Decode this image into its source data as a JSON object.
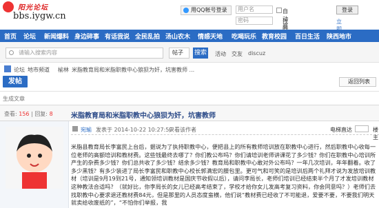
{
  "site": {
    "logo_cn": "阳光论坛",
    "logo_url": "bbs.iygw.cn"
  },
  "login": {
    "qq_label": "用QQ帐号登录",
    "user_placeholder": "用户名",
    "pass_placeholder": "密码",
    "autologin": "自动登录",
    "find_password": "找回密码",
    "login_btn": "登录",
    "register": "立即注册"
  },
  "nav": [
    "首页",
    "论坛",
    "新闻爆料",
    "身边碎事",
    "有话我说",
    "全民乱拍",
    "汤山农木",
    "情感天地",
    "吃喝玩乐",
    "教育校园",
    "百日生活",
    "陕西地市"
  ],
  "search": {
    "placeholder": "请输入搜索内容",
    "type": "帖子",
    "button": "搜索",
    "hot": [
      "活动",
      "交友",
      "discuz"
    ]
  },
  "breadcrumb": [
    "论坛",
    "地市频道",
    "榆林",
    "米脂教育局和米脂职教中心狼狈为奸，坑害教师 ..."
  ],
  "post_btn": "发帖",
  "back_btn": "返回列表",
  "tag": "生成文章",
  "stats": {
    "view_label": "查看:",
    "views": "156",
    "reply_label": "回复:",
    "replies": "8"
  },
  "thread_title": "米脂教育局和米脂职教中心狼狈为奸，坑害教师",
  "meta": {
    "author": "宛瑜",
    "posted": "发表于 2014-10-22 10:27:50",
    "only_author": "只看该作者",
    "mode": "电梯直达",
    "floor": "楼主"
  },
  "body": "米脂县教育局长李富民上台后，据说为了执持职教中心，便把县上的所有教师培训放在职教中心进行，然后职教中心收每一位老师的高额培训和教材费。这些钱最终去哪了？你们教公布吗？你们请培训老师讲课花了多少钱？你们在职教中心培训所产生的杂费多少钱？你们总共收了多少钱？结余多少钱？教育局和职教中心敢对外公布吗？一年几次培训，年年翻着。收了多少黑钱？有多少装进了局长李富民和职教中心校长郭满宏的腰包里。更可气和可笑的是培训后两个礼拜才说为发放培训教材（培训是9月19到21号，通知领培训教材是国庆节收假以后），请问李局长，老师们培训已经结束半个月了才发培训教材这种教法合适吗？（就好比，你李局长的女儿已经高考结束了，学校才给你女儿发高考复习资料，你会同意吗？）老师们去找职教中心要求退还教材费84元，但是那里的人员态度蛮横，他们说“教材费已经收了不可能退，爱要不要，不要我们明天就卖给收废纸的”，“不怕你们举报，我"
}
